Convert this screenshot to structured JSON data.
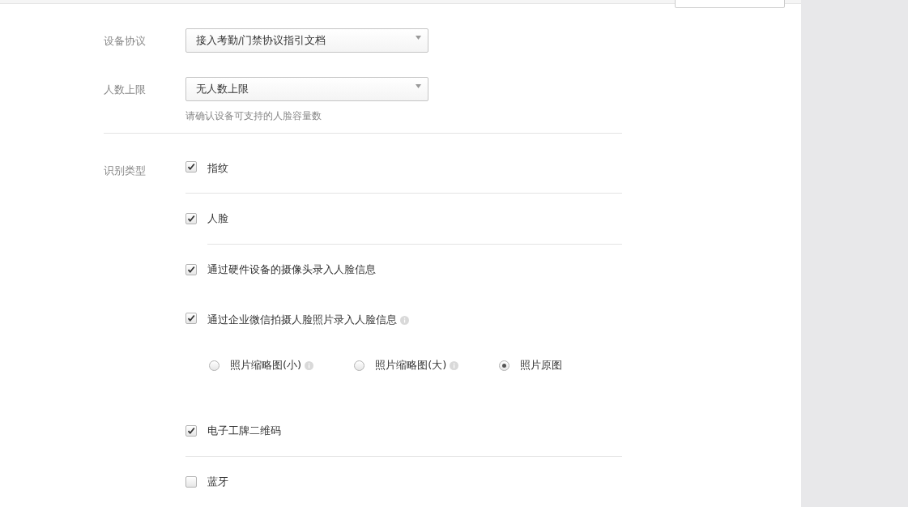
{
  "fields": [
    {
      "label": "设备协议",
      "value": "接入考勤/门禁协议指引文档"
    },
    {
      "label": "人数上限",
      "value": "无人数上限",
      "hint": "请确认设备可支持的人脸容量数"
    }
  ],
  "recognition": {
    "label": "识别类型",
    "items": [
      {
        "label": "指纹",
        "checked": true,
        "info": false
      },
      {
        "label": "人脸",
        "checked": true,
        "info": false
      },
      {
        "label": "通过硬件设备的摄像头录入人脸信息",
        "checked": true,
        "info": false
      },
      {
        "label": "通过企业微信拍摄人脸照片录入人脸信息",
        "checked": true,
        "info": true,
        "options": [
          {
            "label": "照片缩略图(小)",
            "selected": false,
            "info": true
          },
          {
            "label": "照片缩略图(大)",
            "selected": false,
            "info": true
          },
          {
            "label": "照片原图",
            "selected": true,
            "info": false
          }
        ]
      },
      {
        "label": "电子工牌二维码",
        "checked": true,
        "info": false
      },
      {
        "label": "蓝牙",
        "checked": false,
        "info": false
      }
    ]
  }
}
